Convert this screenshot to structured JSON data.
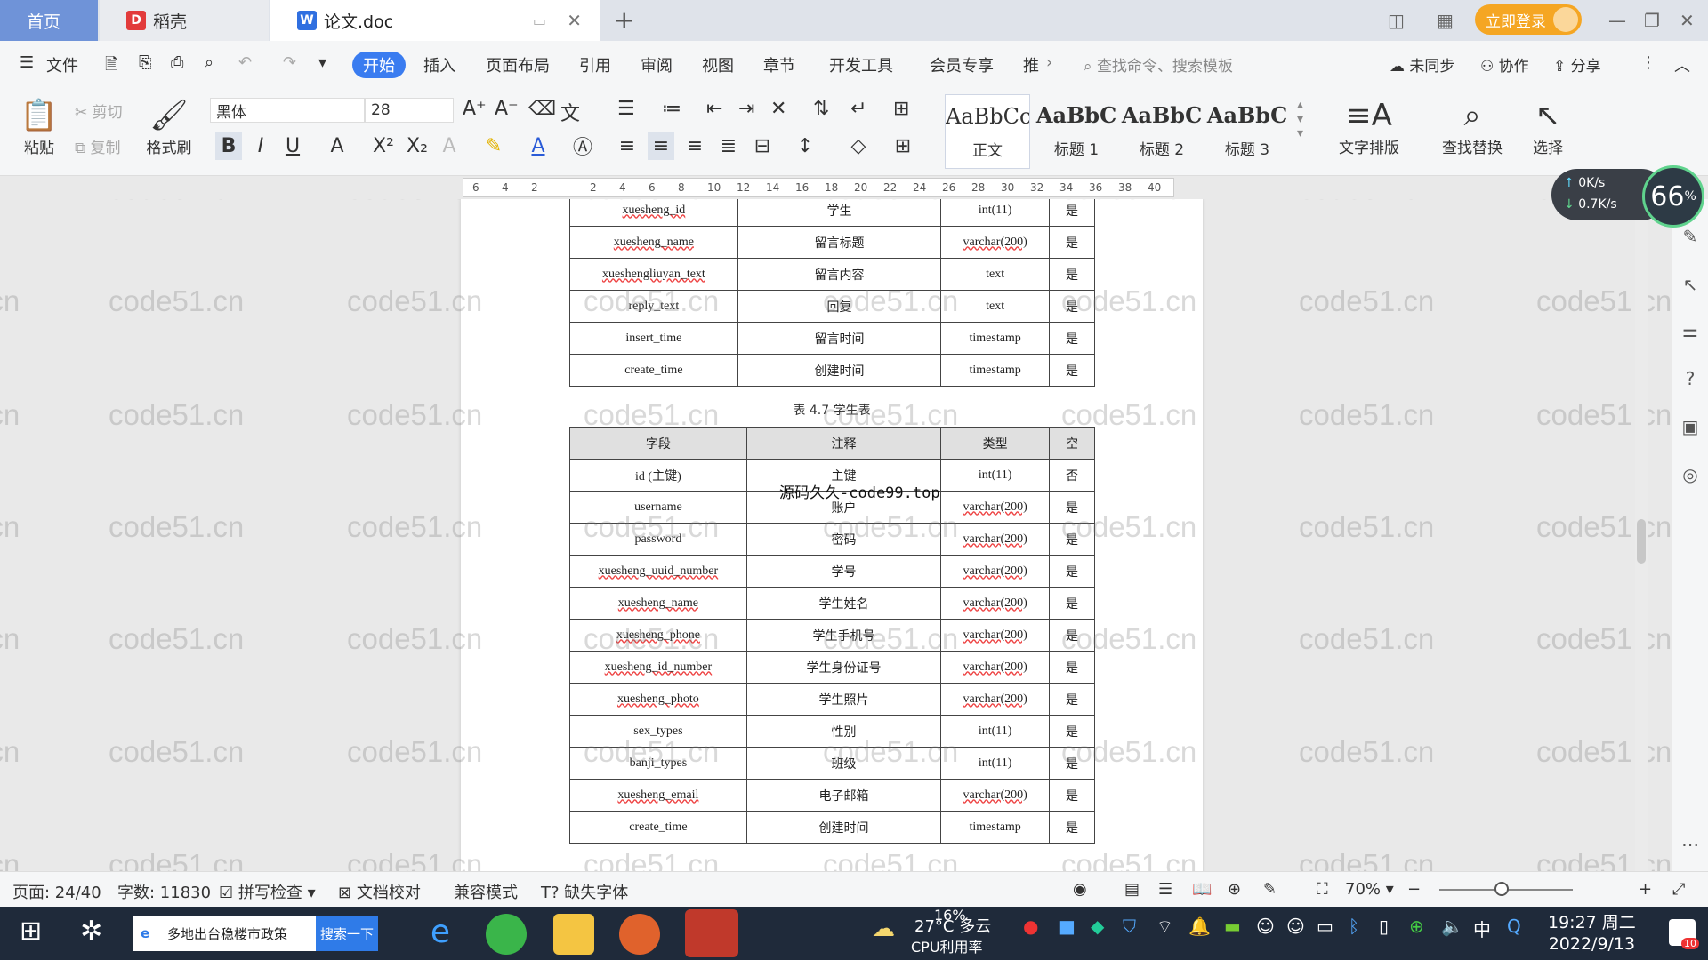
{
  "tabs": {
    "home": "首页",
    "docer": "稻壳",
    "doc": "论文.doc"
  },
  "titlebar": {
    "login": "立即登录"
  },
  "menu": {
    "file": "文件",
    "items": [
      "开始",
      "插入",
      "页面布局",
      "引用",
      "审阅",
      "视图",
      "章节",
      "开发工具",
      "会员专享",
      "推"
    ],
    "search_cmd": "查找命令、搜索模板",
    "sync": "未同步",
    "collab": "协作",
    "share": "分享"
  },
  "ribbon": {
    "paste": "粘贴",
    "cut": "剪切",
    "copy": "复制",
    "format_painter": "格式刷",
    "font_name": "黑体",
    "font_size": "28",
    "styles": [
      {
        "preview": "AaBbCcI",
        "label": "正文"
      },
      {
        "preview": "AaBbC",
        "label": "标题 1"
      },
      {
        "preview": "AaBbC",
        "label": "标题 2"
      },
      {
        "preview": "AaBbC",
        "label": "标题 3"
      }
    ],
    "text_layout": "文字排版",
    "find_replace": "查找替换",
    "select": "选择"
  },
  "ruler": {
    "ticks": [
      "6",
      "4",
      "2",
      "",
      "2",
      "4",
      "6",
      "8",
      "10",
      "12",
      "14",
      "16",
      "18",
      "20",
      "22",
      "24",
      "26",
      "28",
      "30",
      "32",
      "34",
      "36",
      "38",
      "40"
    ]
  },
  "document": {
    "table1_rows": [
      {
        "field": "xuesheng_id",
        "comment": "学生",
        "type": "int(11)",
        "null": "是"
      },
      {
        "field": "xuesheng_name",
        "comment": "留言标题",
        "type": "varchar(200)",
        "null": "是"
      },
      {
        "field": "xueshengliuyan_text",
        "comment": "留言内容",
        "type": "text",
        "null": "是"
      },
      {
        "field": "reply_text",
        "comment": "回复",
        "type": "text",
        "null": "是"
      },
      {
        "field": "insert_time",
        "comment": "留言时间",
        "type": "timestamp",
        "null": "是"
      },
      {
        "field": "create_time",
        "comment": "创建时间",
        "type": "timestamp",
        "null": "是"
      }
    ],
    "table2_caption": "表 4.7 学生表",
    "table2_headers": [
      "字段",
      "注释",
      "类型",
      "空"
    ],
    "table2_rows": [
      {
        "field": "id (主键)",
        "comment": "主键",
        "type": "int(11)",
        "null": "否"
      },
      {
        "field": "username",
        "comment": "账户",
        "type": "varchar(200)",
        "null": "是"
      },
      {
        "field": "password",
        "comment": "密码",
        "type": "varchar(200)",
        "null": "是"
      },
      {
        "field": "xuesheng_uuid_number",
        "comment": "学号",
        "type": "varchar(200)",
        "null": "是"
      },
      {
        "field": "xuesheng_name",
        "comment": "学生姓名",
        "type": "varchar(200)",
        "null": "是"
      },
      {
        "field": "xuesheng_phone",
        "comment": "学生手机号",
        "type": "varchar(200)",
        "null": "是"
      },
      {
        "field": "xuesheng_id_number",
        "comment": "学生身份证号",
        "type": "varchar(200)",
        "null": "是"
      },
      {
        "field": "xuesheng_photo",
        "comment": "学生照片",
        "type": "varchar(200)",
        "null": "是"
      },
      {
        "field": "sex_types",
        "comment": "性别",
        "type": "int(11)",
        "null": "是"
      },
      {
        "field": "banji_types",
        "comment": "班级",
        "type": "int(11)",
        "null": "是"
      },
      {
        "field": "xuesheng_email",
        "comment": "电子邮箱",
        "type": "varchar(200)",
        "null": "是"
      },
      {
        "field": "create_time",
        "comment": "创建时间",
        "type": "timestamp",
        "null": "是"
      }
    ],
    "overlay_text": "源码久久-code99.top",
    "watermark": "code51.cn"
  },
  "speed_widget": {
    "up": "0K/s",
    "down": "0.7K/s",
    "percent": "66",
    "percent_unit": "%"
  },
  "statusbar": {
    "page": "页面: 24/40",
    "words": "字数: 11830",
    "spell": "拼写检查",
    "proofread": "文档校对",
    "compat": "兼容模式",
    "missing_font": "缺失字体",
    "zoom": "70%"
  },
  "taskbar": {
    "news": "多地出台稳楼市政策",
    "search_btn": "搜索一下",
    "weather": "27°C 多云",
    "cpu_percent": "16%",
    "cpu_label": "CPU利用率",
    "ime": "中",
    "time": "19:27 周二",
    "date": "2022/9/13",
    "notif": "10"
  },
  "colors": {
    "accent": "#3a7cf0",
    "login": "#f5a623",
    "home_tab": "#6f93d8"
  }
}
